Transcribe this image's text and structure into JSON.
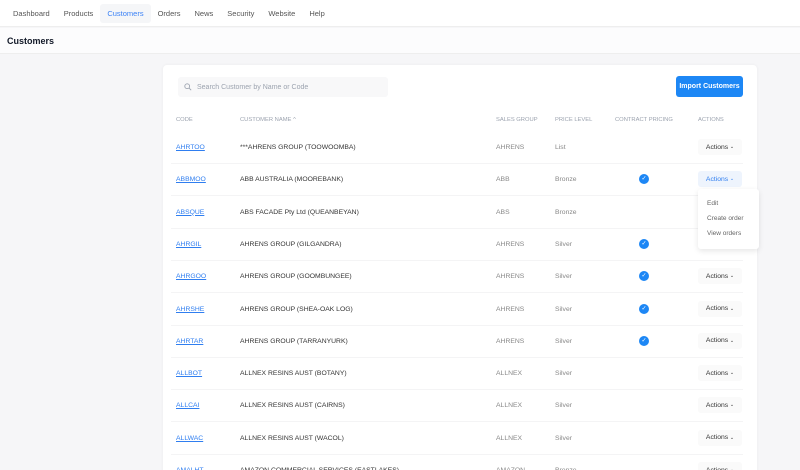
{
  "nav": {
    "items": [
      "Dashboard",
      "Products",
      "Customers",
      "Orders",
      "News",
      "Security",
      "Website",
      "Help"
    ],
    "active": "Customers"
  },
  "page_title": "Customers",
  "search": {
    "placeholder": "Search Customer by Name or Code",
    "value": ""
  },
  "import_label": "Import Customers",
  "columns": [
    "CODE",
    "CUSTOMER NAME",
    "SALES GROUP",
    "PRICE LEVEL",
    "CONTRACT PRICING",
    "ACTIONS"
  ],
  "sort_icon": "chevron-up-icon",
  "actions_label": "Actions",
  "accent": "#1d87f5",
  "rows": [
    {
      "code": "AHRTOO",
      "name": "***AHRENS GROUP (TOOWOOMBA)",
      "group": "AHRENS",
      "price": "List",
      "contract": false
    },
    {
      "code": "ABBMOO",
      "name": "ABB AUSTRALIA (MOOREBANK)",
      "group": "ABB",
      "price": "Bronze",
      "contract": true
    },
    {
      "code": "ABSQUE",
      "name": "ABS FACADE Pty Ltd (QUEANBEYAN)",
      "group": "ABS",
      "price": "Bronze",
      "contract": false
    },
    {
      "code": "AHRGIL",
      "name": "AHRENS GROUP (GILGANDRA)",
      "group": "AHRENS",
      "price": "Silver",
      "contract": true
    },
    {
      "code": "AHRGOO",
      "name": "AHRENS GROUP (GOOMBUNGEE)",
      "group": "AHRENS",
      "price": "Silver",
      "contract": true
    },
    {
      "code": "AHRSHE",
      "name": "AHRENS GROUP (SHEA-OAK LOG)",
      "group": "AHRENS",
      "price": "Silver",
      "contract": true
    },
    {
      "code": "AHRTAR",
      "name": "AHRENS GROUP (TARRANYURK)",
      "group": "AHRENS",
      "price": "Silver",
      "contract": true
    },
    {
      "code": "ALLBOT",
      "name": "ALLNEX RESINS AUST (BOTANY)",
      "group": "ALLNEX",
      "price": "Silver",
      "contract": false
    },
    {
      "code": "ALLCAI",
      "name": "ALLNEX RESINS AUST (CAIRNS)",
      "group": "ALLNEX",
      "price": "Silver",
      "contract": false
    },
    {
      "code": "ALLWAC",
      "name": "ALLNEX RESINS AUST (WACOL)",
      "group": "ALLNEX",
      "price": "Silver",
      "contract": false
    },
    {
      "code": "AMALHT",
      "name": "AMAZON COMMERCIAL SERVICES (EASTLAKES)",
      "group": "AMAZON",
      "price": "Bronze",
      "contract": false
    }
  ],
  "open_menu": {
    "row": 1,
    "items": [
      "Edit",
      "Create order",
      "View orders"
    ]
  }
}
